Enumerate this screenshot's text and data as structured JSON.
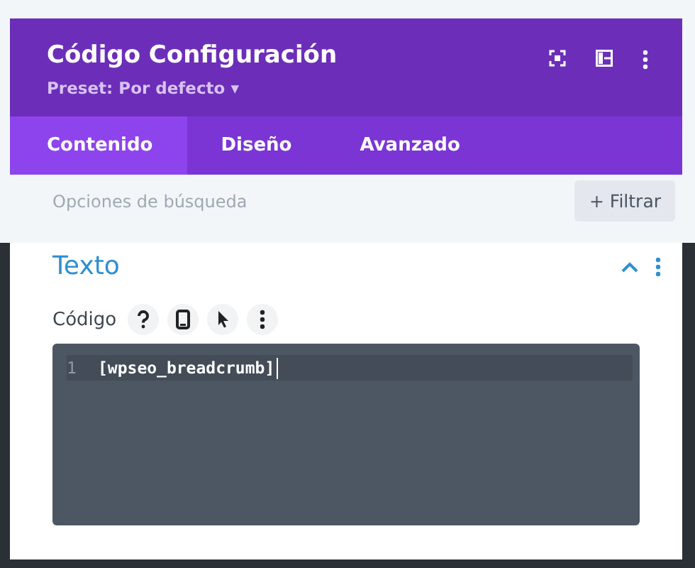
{
  "header": {
    "title": "Código Configuración",
    "preset": "Preset: Por defecto ▾"
  },
  "tabs": [
    {
      "label": "Contenido",
      "selected": true
    },
    {
      "label": "Diseño",
      "selected": false
    },
    {
      "label": "Avanzado",
      "selected": false
    }
  ],
  "search": {
    "placeholder": "Opciones de búsqueda",
    "filter_button": "+ Filtrar"
  },
  "section": {
    "title": "Texto",
    "expanded": true,
    "field_label": "Código",
    "editor_lines": [
      {
        "number": "1",
        "code": "[wpseo_breadcrumb]"
      }
    ]
  }
}
